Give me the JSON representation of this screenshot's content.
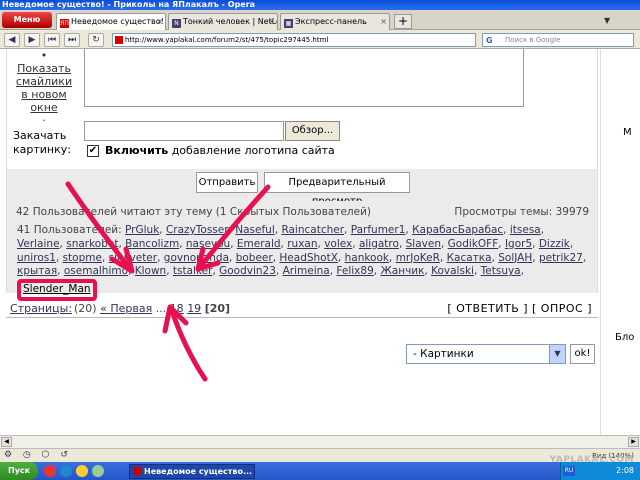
{
  "window": {
    "title": "Неведомое существо! - Приколы на ЯПлакалъ - Opera"
  },
  "tabs": [
    {
      "label": "Неведомое существо! -...",
      "active": true
    },
    {
      "label": "Тонкий человек | NetLo...",
      "active": false
    },
    {
      "label": "Экспресс-панель",
      "active": false
    }
  ],
  "menu_label": "Меню",
  "address": {
    "url": "http://www.yaplakal.com/forum2/st/475/topic297445.html"
  },
  "search": {
    "placeholder": "Поиск в Google"
  },
  "form": {
    "smiley_link": "Показать смайлики в новом окне",
    "upload_label": "Закачать картинку:",
    "browse_label": "Обзор...",
    "logo_bold": "Включить",
    "logo_rest": " добавление логотипа сайта",
    "submit_label": "Отправить",
    "preview_label": "Предварительный просмотр"
  },
  "stats": {
    "readers": "42 Пользователей читают эту тему (1 Скрытых Пользователей)",
    "views": "Просмотры темы: 39979"
  },
  "online": {
    "prefix": "41 Пользователей:",
    "users": [
      "PrGluk",
      "CrazyTosser",
      "Naseful",
      "Raincatcher",
      "Parfumer1",
      "КарабасБарабас",
      "itsesa",
      "Verlaine",
      "snarkobot",
      "Bancolizm",
      "naseyou",
      "Emerald",
      "ruxan",
      "volex",
      "aligatro",
      "Slaven",
      "GodikOFF",
      "Igor5",
      "Dizzik",
      "uniros1",
      "stopme",
      "sinijveter",
      "govnopanda",
      "bobeer",
      "HeadShotX",
      "hankook",
      "mrJoKeR",
      "Касатка",
      "SolJAH",
      "petrik27",
      "крытая",
      "osemalhimo",
      "Klown",
      "tstalker",
      "Goodvin23",
      "Arimeina",
      "Felix89",
      "Жанчик",
      "Kovalski",
      "Tetsuya"
    ],
    "highlighted_user": "Slender_Man"
  },
  "pager": {
    "label": "Страницы:",
    "count": "(20)",
    "first": "« Первая",
    "ellipsis": "...",
    "p18": "18",
    "p19": "19",
    "current": "[20]",
    "actions": "[ ОТВЕТИТЬ ] [ ОПРОС ]"
  },
  "jump": {
    "selected": "- Картинки",
    "ok_label": "ok!"
  },
  "sidebar": {
    "m": "M",
    "blo": "Бло"
  },
  "statusbar": {
    "zoom": "Вид (140%)",
    "watermark": "YAPLAKAL.COM"
  },
  "taskbar": {
    "start_label": "Пуск",
    "window_label": "Неведомое существо...",
    "lang": "RU",
    "clock": "2:08"
  },
  "colors": {
    "annotation": "#e8114f",
    "title_bar": "#0a4fd6",
    "taskbar": "#2456c8"
  }
}
